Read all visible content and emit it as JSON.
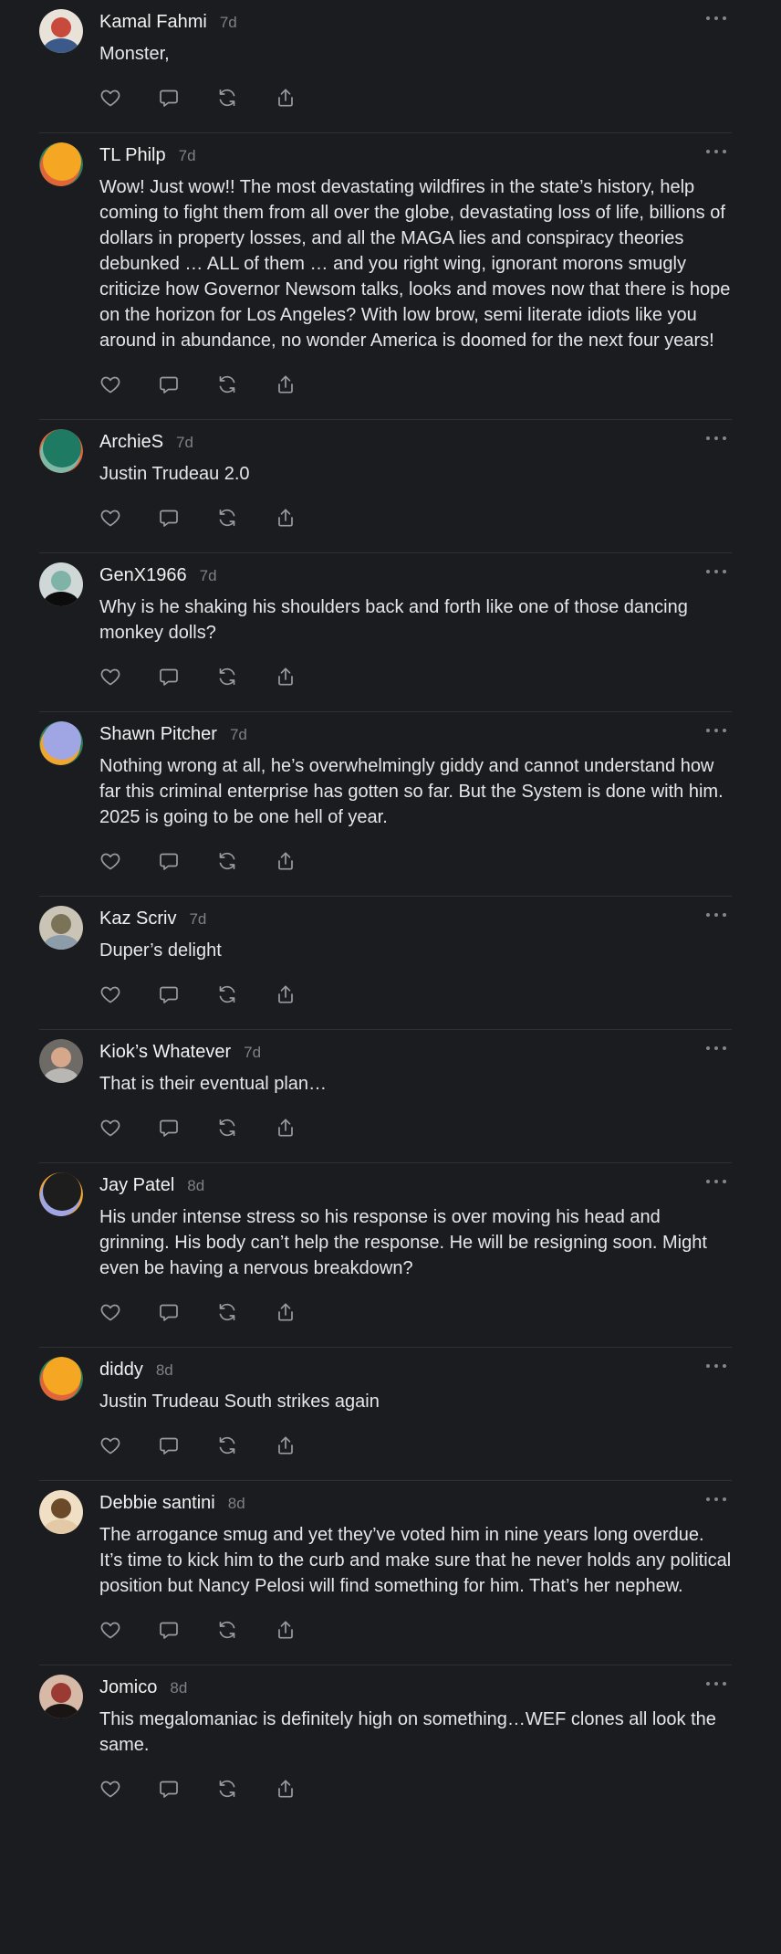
{
  "comments": [
    {
      "author": "Kamal Fahmi",
      "time": "7d",
      "text": "Monster,",
      "avatar": {
        "kind": "photo",
        "colors": [
          "#3b5a8a",
          "#c84a3c",
          "#e8e2d8"
        ]
      }
    },
    {
      "author": "TL Philp",
      "time": "7d",
      "text": "Wow! Just wow!! The most devastating wildfires in the state’s history, help coming to fight them from all over the globe, devastating loss of life, billions of dollars in property losses, and all the MAGA lies and conspiracy theories debunked … ALL of them … and you right wing, ignorant morons smugly criticize how Governor Newsom talks, looks and moves now that there is hope on the horizon for Los Angeles? With low brow, semi literate idiots like you around in abundance, no wonder America is doomed for the next four years!",
      "avatar": {
        "kind": "blob",
        "colors": [
          "#f5a623",
          "#2e7d5b",
          "#e0663a"
        ]
      }
    },
    {
      "author": "ArchieS",
      "time": "7d",
      "text": "Justin Trudeau 2.0",
      "avatar": {
        "kind": "blob",
        "colors": [
          "#1f7a63",
          "#e0663a",
          "#7fb8a5"
        ]
      }
    },
    {
      "author": "GenX1966",
      "time": "7d",
      "text": "Why is he shaking his shoulders back and forth like one of those dancing monkey dolls?",
      "avatar": {
        "kind": "photo",
        "colors": [
          "#0c0c0c",
          "#7fb3a8",
          "#cfd8d6"
        ]
      }
    },
    {
      "author": "Shawn Pitcher",
      "time": "7d",
      "text": "Nothing wrong at all, he’s overwhelmingly giddy and cannot understand how far this criminal enterprise has gotten so far. But the System is done with him. 2025 is going to be one hell of year.",
      "avatar": {
        "kind": "blob",
        "colors": [
          "#9fa6e3",
          "#2e7d5b",
          "#f0a530"
        ]
      }
    },
    {
      "author": "Kaz Scriv",
      "time": "7d",
      "text": "Duper’s delight",
      "avatar": {
        "kind": "photo",
        "colors": [
          "#8c9ca9",
          "#7a7358",
          "#c9c4b6"
        ]
      }
    },
    {
      "author": "Kiok’s Whatever",
      "time": "7d",
      "text": "That is their eventual plan…",
      "avatar": {
        "kind": "photo",
        "colors": [
          "#b9b7b4",
          "#d6a78a",
          "#6e6a66"
        ]
      }
    },
    {
      "author": "Jay Patel",
      "time": "8d",
      "text": "His under intense stress so his response is over moving his head and grinning. His body can’t help the response. He will be resigning soon. Might even be having a nervous breakdown?",
      "avatar": {
        "kind": "blob",
        "colors": [
          "#1d1d1d",
          "#f0a530",
          "#9fa6e3"
        ]
      }
    },
    {
      "author": "diddy",
      "time": "8d",
      "text": "Justin Trudeau South strikes again",
      "avatar": {
        "kind": "blob",
        "colors": [
          "#f5a623",
          "#2e7d5b",
          "#e0663a"
        ]
      }
    },
    {
      "author": "Debbie santini",
      "time": "8d",
      "text": "The arrogance smug and yet they’ve voted him in nine years long overdue. It’s time to kick him to the curb and make sure that he never holds any political position but Nancy Pelosi will find something for him. That’s her nephew.",
      "avatar": {
        "kind": "photo",
        "colors": [
          "#e3c9a5",
          "#6b4a2a",
          "#f0dfc4"
        ]
      }
    },
    {
      "author": "Jomico",
      "time": "8d",
      "text": "This megalomaniac is definitely high on something…WEF clones all look the same.",
      "avatar": {
        "kind": "photo",
        "colors": [
          "#1a1414",
          "#9a3a32",
          "#d7b9a8"
        ]
      }
    }
  ],
  "icons": {
    "like": "heart-icon",
    "reply": "comment-icon",
    "restack": "repost-icon",
    "share": "share-icon",
    "more": "more-options-icon"
  },
  "colors": {
    "background": "#1b1c1f",
    "text": "#e6e6e8",
    "muted": "#7f8086",
    "icon": "#9a9ba1"
  }
}
